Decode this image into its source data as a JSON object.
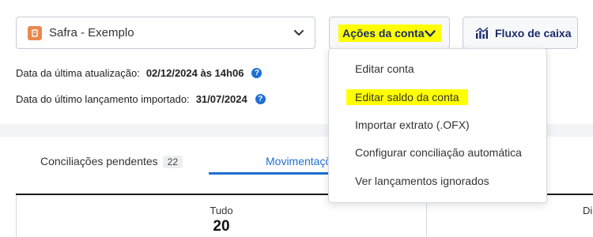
{
  "account": {
    "name": "Safra - Exemplo"
  },
  "toolbar": {
    "actions_label": "Ações da conta",
    "cashflow_label": "Fluxo de caixa"
  },
  "info": {
    "last_update_label": "Data da última atualização:",
    "last_update_value": "02/12/2024 às 14h06",
    "last_import_label": "Data do último lançamento importado:",
    "last_import_value": "31/07/2024"
  },
  "tabs": {
    "pending_label": "Conciliações pendentes",
    "pending_count": "22",
    "movements_label": "Movimentações"
  },
  "summary": {
    "all_label": "Tudo",
    "all_value": "20",
    "right_label": "Di"
  },
  "actions_menu": {
    "items": [
      "Editar conta",
      "Editar saldo da conta",
      "Importar extrato (.OFX)",
      "Configurar conciliação automática",
      "Ver lançamentos ignorados"
    ]
  },
  "colors": {
    "highlight": "#ffff00",
    "primary": "#1f6fd1",
    "button_text": "#1a2b6b",
    "bank_logo": "#e8894e"
  },
  "icons": {
    "bank": "bank-logo-icon",
    "select": "chevron-down-icon",
    "cashflow": "bar-chart-icon",
    "help": "help-circle-icon"
  }
}
